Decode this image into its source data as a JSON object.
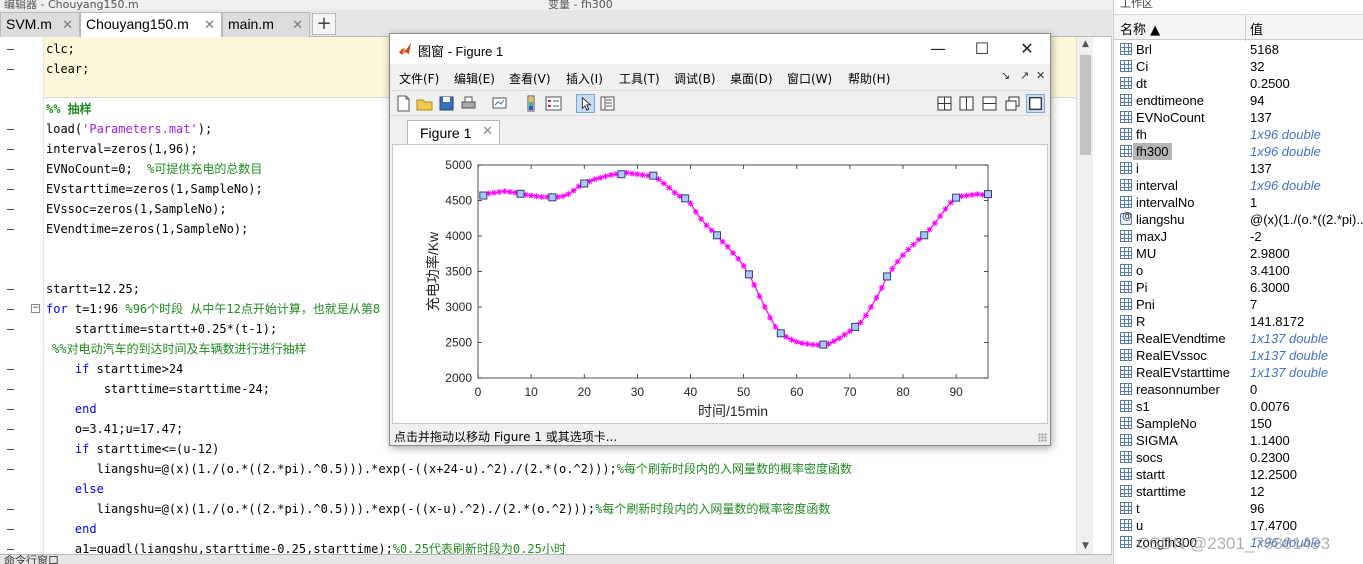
{
  "top": {
    "left_text": "编辑器 - Chouyang150.m",
    "mid_text": "变量 - fh300"
  },
  "editor": {
    "tabs": [
      {
        "label": "SVM.m",
        "active": false
      },
      {
        "label": "Chouyang150.m",
        "active": true
      },
      {
        "label": "main.m",
        "active": false
      }
    ],
    "add_tab": "+",
    "lines": [
      {
        "gutter": "–",
        "parts": [
          {
            "c": "",
            "t": "clc;"
          }
        ],
        "indent": 0
      },
      {
        "gutter": "–",
        "parts": [
          {
            "c": "",
            "t": "clear;"
          }
        ],
        "indent": 0
      },
      {
        "gutter": "",
        "parts": [],
        "indent": 0
      },
      {
        "gutter": "",
        "parts": [
          {
            "c": "sec",
            "t": "%% 抽样"
          }
        ],
        "indent": 0
      },
      {
        "gutter": "–",
        "parts": [
          {
            "c": "",
            "t": "load("
          },
          {
            "c": "st",
            "t": "'Parameters.mat'"
          },
          {
            "c": "",
            "t": ");"
          }
        ],
        "indent": 0
      },
      {
        "gutter": "–",
        "parts": [
          {
            "c": "",
            "t": "interval=zeros(1,96);"
          }
        ],
        "indent": 0
      },
      {
        "gutter": "–",
        "parts": [
          {
            "c": "",
            "t": "EVNoCount=0;  "
          },
          {
            "c": "cm",
            "t": "%可提供充电的总数目"
          }
        ],
        "indent": 0
      },
      {
        "gutter": "–",
        "parts": [
          {
            "c": "",
            "t": "EVstarttime=zeros(1,SampleNo);"
          }
        ],
        "indent": 0
      },
      {
        "gutter": "–",
        "parts": [
          {
            "c": "",
            "t": "EVssoc=zeros(1,SampleNo);"
          }
        ],
        "indent": 0
      },
      {
        "gutter": "–",
        "parts": [
          {
            "c": "",
            "t": "EVendtime=zeros(1,SampleNo);"
          }
        ],
        "indent": 0
      },
      {
        "gutter": "",
        "parts": [],
        "indent": 0
      },
      {
        "gutter": "",
        "parts": [],
        "indent": 0
      },
      {
        "gutter": "–",
        "parts": [
          {
            "c": "",
            "t": "startt=12.25;"
          }
        ],
        "indent": 0
      },
      {
        "gutter": "–",
        "fold": true,
        "parts": [
          {
            "c": "kw",
            "t": "for"
          },
          {
            "c": "",
            "t": " t=1:96 "
          },
          {
            "c": "cm",
            "t": "%96个时段 从中午12点开始计算，也就是从第8"
          }
        ],
        "indent": 0
      },
      {
        "gutter": "–",
        "parts": [
          {
            "c": "",
            "t": "starttime=startt+0.25*(t-1);"
          }
        ],
        "indent": 4
      },
      {
        "gutter": "",
        "parts": [
          {
            "c": "cm",
            "t": "%%对电动汽车的到达时间及车辆数进行进行抽样"
          }
        ],
        "indent": -1
      },
      {
        "gutter": "–",
        "parts": [
          {
            "c": "kw",
            "t": "if"
          },
          {
            "c": "",
            "t": " starttime>24"
          }
        ],
        "indent": 4
      },
      {
        "gutter": "–",
        "parts": [
          {
            "c": "",
            "t": "starttime=starttime-24;"
          }
        ],
        "indent": 8
      },
      {
        "gutter": "–",
        "parts": [
          {
            "c": "kw",
            "t": "end"
          }
        ],
        "indent": 4
      },
      {
        "gutter": "–",
        "parts": [
          {
            "c": "",
            "t": "o=3.41;u=17.47;"
          }
        ],
        "indent": 4
      },
      {
        "gutter": "–",
        "parts": [
          {
            "c": "kw",
            "t": "if"
          },
          {
            "c": "",
            "t": " starttime<=(u-12)"
          }
        ],
        "indent": 4
      },
      {
        "gutter": "–",
        "parts": [
          {
            "c": "",
            "t": "liangshu=@(x)(1./(o.*((2.*pi).^0.5))).*exp(-((x+24-u).^2)./(2.*(o.^2)));"
          },
          {
            "c": "cm",
            "t": "%每个刷新时段内的入网量数的概率密度函数"
          }
        ],
        "indent": 7
      },
      {
        "gutter": "",
        "parts": [
          {
            "c": "kw",
            "t": "else"
          }
        ],
        "indent": 4
      },
      {
        "gutter": "–",
        "parts": [
          {
            "c": "",
            "t": "liangshu=@(x)(1./(o.*((2.*pi).^0.5))).*exp(-((x-u).^2)./(2.*(o.^2)));"
          },
          {
            "c": "cm",
            "t": "%每个刷新时段内的入网量数的概率密度函数"
          }
        ],
        "indent": 7
      },
      {
        "gutter": "–",
        "parts": [
          {
            "c": "kw",
            "t": "end"
          }
        ],
        "indent": 4
      },
      {
        "gutter": "–",
        "parts": [
          {
            "c": "",
            "t": "a1=quadl(liangshu,starttime-0.25,starttime);"
          },
          {
            "c": "cm",
            "t": "%0.25代表刷新时段为0.25小时"
          }
        ],
        "indent": 4
      }
    ]
  },
  "command_window": {
    "title": "命令行窗口"
  },
  "workspace": {
    "title": "工作区",
    "col_name": "名称 ▲",
    "col_value": "值",
    "vars": [
      {
        "name": "Brl",
        "value": "5168",
        "dim": false
      },
      {
        "name": "Ci",
        "value": "32",
        "dim": false
      },
      {
        "name": "dt",
        "value": "0.2500",
        "dim": false
      },
      {
        "name": "endtimeone",
        "value": "94",
        "dim": false
      },
      {
        "name": "EVNoCount",
        "value": "137",
        "dim": false
      },
      {
        "name": "fh",
        "value": "1x96 double",
        "dim": true
      },
      {
        "name": "fh300",
        "value": "1x96 double",
        "dim": true,
        "selected": true
      },
      {
        "name": "i",
        "value": "137",
        "dim": false
      },
      {
        "name": "interval",
        "value": "1x96 double",
        "dim": true
      },
      {
        "name": "intervalNo",
        "value": "1",
        "dim": false
      },
      {
        "name": "liangshu",
        "value": "@(x)(1./(o.*((2.*pi)...",
        "dim": false,
        "fn": true
      },
      {
        "name": "maxJ",
        "value": "-2",
        "dim": false
      },
      {
        "name": "MU",
        "value": "2.9800",
        "dim": false
      },
      {
        "name": "o",
        "value": "3.4100",
        "dim": false
      },
      {
        "name": "Pi",
        "value": "6.3000",
        "dim": false
      },
      {
        "name": "Pni",
        "value": "7",
        "dim": false
      },
      {
        "name": "R",
        "value": "141.8172",
        "dim": false
      },
      {
        "name": "RealEVendtime",
        "value": "1x137 double",
        "dim": true
      },
      {
        "name": "RealEVssoc",
        "value": "1x137 double",
        "dim": true
      },
      {
        "name": "RealEVstarttime",
        "value": "1x137 double",
        "dim": true
      },
      {
        "name": "reasonnumber",
        "value": "0",
        "dim": false
      },
      {
        "name": "s1",
        "value": "0.0076",
        "dim": false
      },
      {
        "name": "SampleNo",
        "value": "150",
        "dim": false
      },
      {
        "name": "SIGMA",
        "value": "1.1400",
        "dim": false
      },
      {
        "name": "socs",
        "value": "0.2300",
        "dim": false
      },
      {
        "name": "startt",
        "value": "12.2500",
        "dim": false
      },
      {
        "name": "starttime",
        "value": "12",
        "dim": false
      },
      {
        "name": "t",
        "value": "96",
        "dim": false
      },
      {
        "name": "u",
        "value": "17.4700",
        "dim": false
      },
      {
        "name": "zongfh300",
        "value": "1x96 double",
        "dim": true
      }
    ]
  },
  "watermark": "CSDN @2301_76881493",
  "figure": {
    "title": "图窗 - Figure 1",
    "min": "—",
    "max": "☐",
    "close": "✕",
    "menus": [
      "文件(F)",
      "编辑(E)",
      "查看(V)",
      "插入(I)",
      "工具(T)",
      "调试(B)",
      "桌面(D)",
      "窗口(W)",
      "帮助(H)"
    ],
    "tab_label": "Figure 1",
    "status": "点击并拖动以移动 Figure 1 或其选项卡..."
  },
  "chart_data": {
    "type": "line",
    "xlabel": "时间/15min",
    "ylabel": "充电功率/Kw",
    "xlim": [
      0,
      96
    ],
    "ylim": [
      2000,
      5000
    ],
    "xticks": [
      0,
      10,
      20,
      30,
      40,
      50,
      60,
      70,
      80,
      90
    ],
    "yticks": [
      2000,
      2500,
      3000,
      3500,
      4000,
      4500,
      5000
    ],
    "grid": false,
    "colors": {
      "line": "#ff00ff",
      "square_marker": "#3a3a6a",
      "square_fill": "#a8c8ff"
    },
    "series": [
      {
        "x": [
          1,
          2,
          3,
          4,
          5,
          6,
          7,
          8,
          9,
          10,
          11,
          12,
          13,
          14,
          15,
          16,
          17,
          18,
          19,
          20,
          21,
          22,
          23,
          24,
          25,
          26,
          27,
          28,
          29,
          30,
          31,
          32,
          33,
          34,
          35,
          36,
          37,
          38,
          39,
          40,
          41,
          42,
          43,
          44,
          45,
          46,
          47,
          48,
          49,
          50,
          51,
          52,
          53,
          54,
          55,
          56,
          57,
          58,
          59,
          60,
          61,
          62,
          63,
          64,
          65,
          66,
          67,
          68,
          69,
          70,
          71,
          72,
          73,
          74,
          75,
          76,
          77,
          78,
          79,
          80,
          81,
          82,
          83,
          84,
          85,
          86,
          87,
          88,
          89,
          90,
          91,
          92,
          93,
          94,
          95,
          96
        ],
        "y": [
          4570,
          4600,
          4610,
          4620,
          4630,
          4620,
          4610,
          4595,
          4580,
          4570,
          4560,
          4550,
          4550,
          4545,
          4550,
          4560,
          4590,
          4640,
          4700,
          4740,
          4770,
          4800,
          4820,
          4840,
          4860,
          4870,
          4880,
          4890,
          4880,
          4870,
          4860,
          4850,
          4840,
          4800,
          4740,
          4680,
          4610,
          4560,
          4530,
          4460,
          4340,
          4240,
          4150,
          4080,
          4010,
          3920,
          3850,
          3760,
          3680,
          3580,
          3460,
          3310,
          3150,
          3000,
          2850,
          2720,
          2630,
          2580,
          2540,
          2510,
          2490,
          2480,
          2470,
          2465,
          2470,
          2480,
          2520,
          2560,
          2610,
          2660,
          2720,
          2780,
          2880,
          3000,
          3130,
          3270,
          3430,
          3540,
          3640,
          3730,
          3810,
          3880,
          3950,
          4010,
          4090,
          4180,
          4280,
          4380,
          4470,
          4540,
          4560,
          4570,
          4580,
          4590,
          4580,
          4590
        ]
      },
      {
        "name": "",
        "x": [
          1,
          8,
          14,
          20,
          27,
          33,
          39,
          45,
          51,
          57,
          65,
          71,
          77,
          84,
          90,
          96
        ],
        "y": [
          4570,
          4595,
          4545,
          4740,
          4870,
          4850,
          4530,
          4010,
          3460,
          2630,
          2470,
          2720,
          3430,
          4010,
          4540,
          4590
        ]
      }
    ]
  }
}
